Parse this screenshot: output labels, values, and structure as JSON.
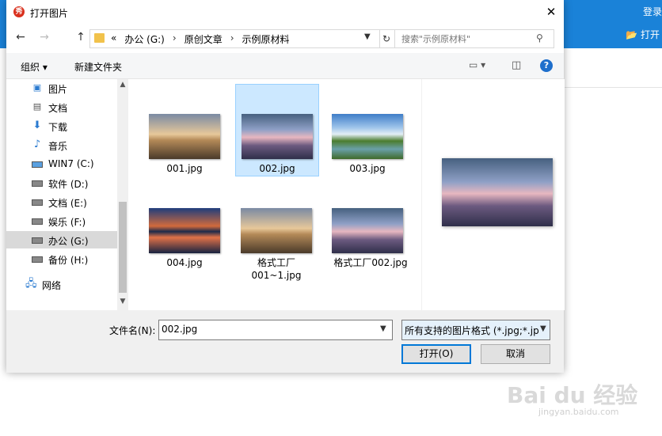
{
  "background": {
    "login_label": "登录",
    "open_label": "打开",
    "watermark": "Bai du 经验",
    "watermark_url": "jingyan.baidu.com"
  },
  "dialog": {
    "title": "打开图片",
    "close": "✕"
  },
  "nav": {
    "back": "←",
    "forward": "→",
    "up": "↑",
    "breadcrumbs": [
      "«",
      "办公 (G:)",
      "›",
      "原创文章",
      "›",
      "示例原材料"
    ],
    "refresh": "↻",
    "search_placeholder": "搜索\"示例原材料\""
  },
  "toolbar": {
    "organize": "组织 ▾",
    "new_folder": "新建文件夹",
    "help": "?"
  },
  "sidebar": {
    "items": [
      {
        "label": "图片",
        "icon": "pictures-icon"
      },
      {
        "label": "文档",
        "icon": "documents-icon"
      },
      {
        "label": "下载",
        "icon": "download-icon"
      },
      {
        "label": "音乐",
        "icon": "music-icon"
      },
      {
        "label": "WIN7 (C:)",
        "icon": "system-drive-icon"
      },
      {
        "label": "软件 (D:)",
        "icon": "drive-icon"
      },
      {
        "label": "文档 (E:)",
        "icon": "drive-icon"
      },
      {
        "label": "娱乐 (F:)",
        "icon": "drive-icon"
      },
      {
        "label": "办公 (G:)",
        "icon": "drive-icon",
        "selected": true
      },
      {
        "label": "备份 (H:)",
        "icon": "drive-icon"
      },
      {
        "label": "网络",
        "icon": "network-icon"
      }
    ]
  },
  "files": [
    {
      "name": "001.jpg"
    },
    {
      "name": "002.jpg",
      "selected": true
    },
    {
      "name": "003.jpg"
    },
    {
      "name": "004.jpg"
    },
    {
      "name": "格式工厂\n001~1.jpg"
    },
    {
      "name": "格式工厂002.jpg"
    }
  ],
  "bottom": {
    "filename_label": "文件名(N):",
    "filename_value": "002.jpg",
    "filter_value": "所有支持的图片格式 (*.jpg;*.jp",
    "open_button": "打开(O)",
    "cancel_button": "取消"
  }
}
